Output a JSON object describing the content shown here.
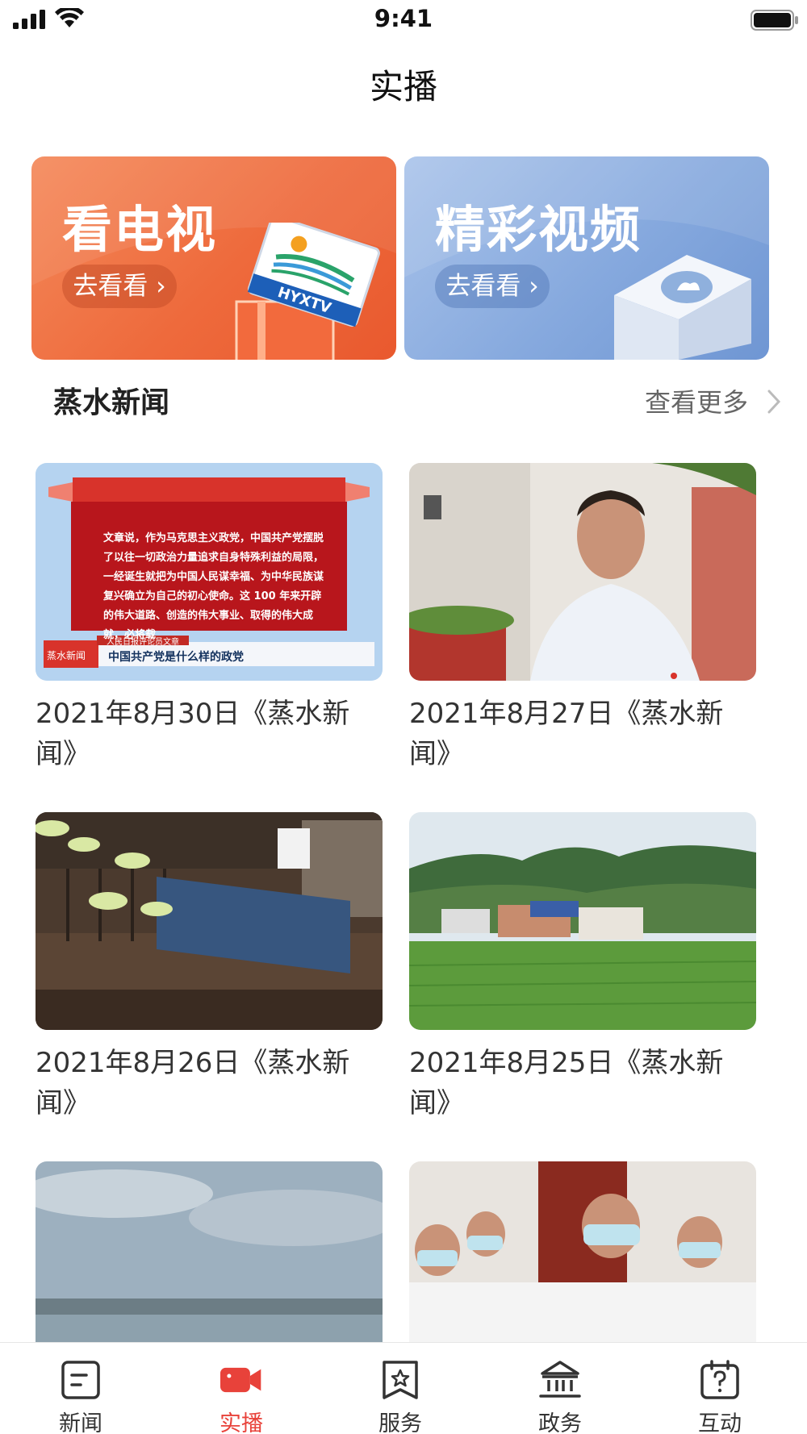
{
  "status_bar": {
    "time": "9:41"
  },
  "header": {
    "title": "实播"
  },
  "banners": [
    {
      "title": "看电视",
      "button": "去看看",
      "logo_text": "HYXTV",
      "color": "#ee6a3c"
    },
    {
      "title": "精彩视频",
      "button": "去看看",
      "color": "#86a9de"
    }
  ],
  "section": {
    "title": "蒸水新闻",
    "more": "查看更多"
  },
  "thumb0": {
    "text": "文章说，作为马克思主义政党，中国共产党摆脱了以往一切政治力量追求自身特殊利益的局限，一经诞生就把为中国人民谋幸福、为中华民族谋复兴确立为自己的初心使命。这 100 年来开辟的伟大道路、创造的伟大事业、取得的伟大成就，必将载",
    "channel": "蒸水新闻",
    "subtitle_small": "人民日报评论员文章",
    "subtitle": "中国共产党是什么样的政党"
  },
  "videos": [
    {
      "caption": "2021年8月30日《蒸水新闻》"
    },
    {
      "caption": "2021年8月27日《蒸水新闻》"
    },
    {
      "caption": "2021年8月26日《蒸水新闻》"
    },
    {
      "caption": "2021年8月25日《蒸水新闻》"
    },
    {
      "caption": ""
    },
    {
      "caption": ""
    }
  ],
  "tabs": [
    {
      "label": "新闻",
      "icon": "news-icon"
    },
    {
      "label": "实播",
      "icon": "live-camera-icon"
    },
    {
      "label": "服务",
      "icon": "service-bookmark-icon"
    },
    {
      "label": "政务",
      "icon": "government-building-icon"
    },
    {
      "label": "互动",
      "icon": "interaction-calendar-icon"
    }
  ],
  "colors": {
    "accent": "#e8423a",
    "text": "#333333",
    "muted": "#666666"
  }
}
